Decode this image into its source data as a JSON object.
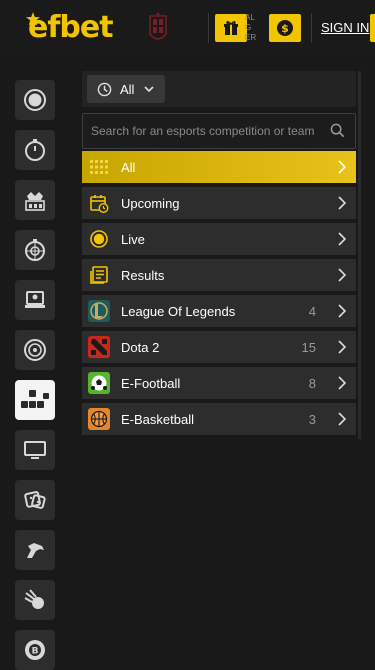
{
  "header": {
    "logo_text": "efbet",
    "gift_label": "AL G ER",
    "sign_in": "SIGN IN"
  },
  "rail": {
    "items": [
      {
        "icon": "record-icon"
      },
      {
        "icon": "stopwatch-icon"
      },
      {
        "icon": "casino-crown-icon"
      },
      {
        "icon": "timer-wheel-icon"
      },
      {
        "icon": "live-dealer-icon"
      },
      {
        "icon": "roulette-icon"
      },
      {
        "icon": "keyboard-icon",
        "active": true
      },
      {
        "icon": "monitor-icon"
      },
      {
        "icon": "dice-icon"
      },
      {
        "icon": "horse-racing-icon"
      },
      {
        "icon": "comet-ball-icon"
      },
      {
        "icon": "bingo-ball-icon"
      }
    ]
  },
  "filter": {
    "label": "All"
  },
  "search": {
    "placeholder": "Search for an esports competition or team"
  },
  "menu": [
    {
      "label": "All",
      "count": "",
      "icon": "grid-icon",
      "active": true
    },
    {
      "label": "Upcoming",
      "count": "",
      "icon": "calendar-clock-icon"
    },
    {
      "label": "Live",
      "count": "",
      "icon": "live-dot-icon"
    },
    {
      "label": "Results",
      "count": "",
      "icon": "results-list-icon"
    },
    {
      "label": "League Of Legends",
      "count": "4",
      "icon": "league-of-legends-icon"
    },
    {
      "label": "Dota 2",
      "count": "15",
      "icon": "dota2-icon"
    },
    {
      "label": "E-Football",
      "count": "8",
      "icon": "efootball-icon"
    },
    {
      "label": "E-Basketball",
      "count": "3",
      "icon": "ebasketball-icon"
    }
  ],
  "colors": {
    "accent": "#f2c500",
    "background": "#191919",
    "row": "#2d2d2d"
  }
}
